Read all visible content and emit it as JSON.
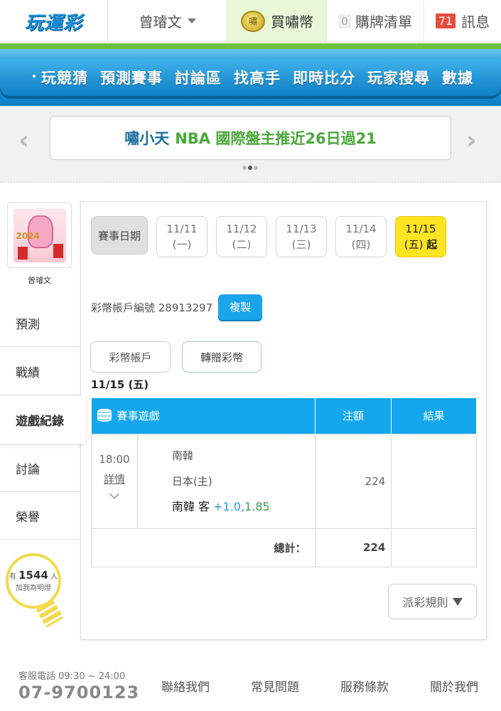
{
  "header": {
    "logo": "玩運彩",
    "user_name": "曾璿文",
    "coin_label": "買嘯幣",
    "coin_icon_text": "嘯",
    "cart_count": "0",
    "cart_label": "購牌清單",
    "message_count": "71",
    "message_label": "訊息"
  },
  "nav": {
    "items": [
      "玩競猜",
      "預測賽事",
      "討論區",
      "找高手",
      "即時比分",
      "玩家搜尋",
      "數據"
    ]
  },
  "banner": {
    "who": "嘯小天",
    "what": "NBA 國際盤主推近26日過21",
    "prev_icon": "‹",
    "next_icon": "›"
  },
  "sidebar": {
    "user_name": "曾璿文",
    "avatar_year": "2024",
    "items": [
      "預測",
      "戰績",
      "遊戲紀錄",
      "討論",
      "榮譽"
    ],
    "active_index": 2,
    "fans_prefix": "有",
    "fans_count": "1544",
    "fans_suffix": "人",
    "fans_text": "加我為明燈"
  },
  "dates": {
    "label": "賽事日期",
    "items": [
      {
        "date": "11/11",
        "weekday": "(一)"
      },
      {
        "date": "11/12",
        "weekday": "(二)"
      },
      {
        "date": "11/13",
        "weekday": "(三)"
      },
      {
        "date": "11/14",
        "weekday": "(四)"
      },
      {
        "date": "11/15",
        "weekday": "(五)",
        "suffix": "起"
      }
    ]
  },
  "account": {
    "label": "彩幣帳戶編號 28913297",
    "copy_label": "複製"
  },
  "tabs": {
    "account": "彩幣帳戶",
    "gift": "轉贈彩幣"
  },
  "games": {
    "date_heading": "11/15 (五)",
    "columns": [
      "賽事遊戲",
      "注額",
      "結果"
    ],
    "rows": [
      {
        "time": "18:00",
        "detail": "詳情",
        "away": "南韓",
        "home": "日本(主)",
        "bet_team": "南韓 客",
        "bet_line": "+1.0,",
        "bet_odds": "1.85",
        "amount": "224",
        "result": ""
      }
    ],
    "total_label": "總計：",
    "total_value": "224"
  },
  "rules_label": "派彩規則",
  "footer": {
    "hotline_label": "客服電話 09:30 ~ 24:00",
    "hotline": "07-9700123",
    "links": [
      "聯絡我們",
      "常見問題",
      "服務條款",
      "關於我們"
    ]
  },
  "colors": {
    "nav_blue": "#0d80c8",
    "accent_green": "#6fc03f",
    "table_header": "#14a7ee",
    "active_date": "#ffe422",
    "copy_button": "#1aa5ea"
  }
}
